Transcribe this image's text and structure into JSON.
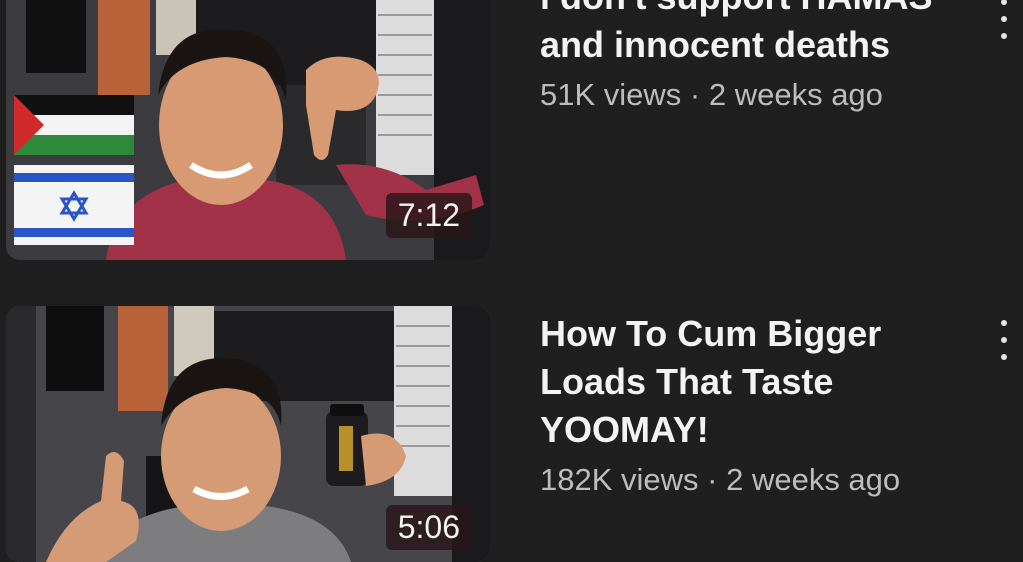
{
  "videos": [
    {
      "title": "i don't support HAMAS and innocent deaths",
      "views": "51K views",
      "age": "2 weeks ago",
      "duration": "7:12"
    },
    {
      "title": "How To Cum Bigger Loads That Taste YOOMAY!",
      "views": "182K views",
      "age": "2 weeks ago",
      "duration": "5:06"
    }
  ],
  "separator": " · ",
  "icons": {
    "more": "vertical-ellipsis-icon",
    "flag_palestine": "palestine-flag-icon",
    "flag_israel": "israel-flag-icon"
  },
  "colors": {
    "background": "#1f1f1f",
    "title": "#f3f3f3",
    "stats": "#bdbdbd"
  }
}
